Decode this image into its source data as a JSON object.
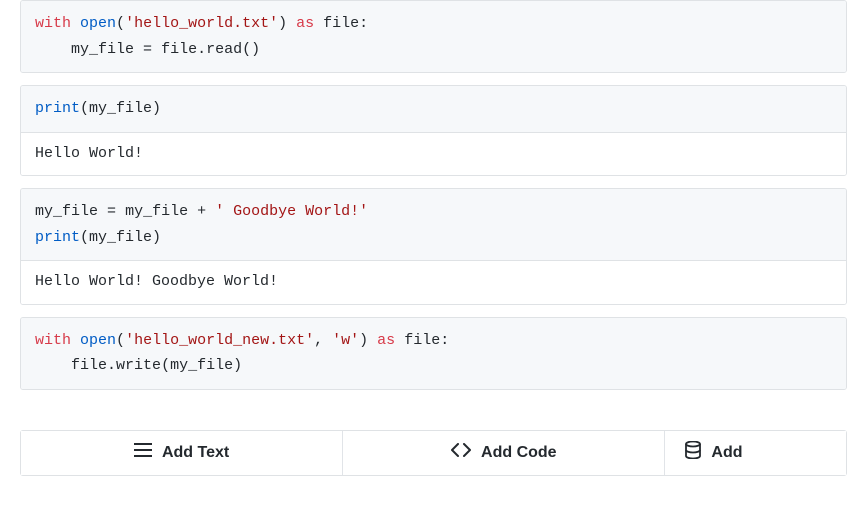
{
  "cells": [
    {
      "code_tokens": [
        [
          "keyword",
          "with"
        ],
        [
          "space",
          " "
        ],
        [
          "builtin",
          "open"
        ],
        [
          "punct",
          "("
        ],
        [
          "string",
          "'hello_world.txt'"
        ],
        [
          "punct",
          ")"
        ],
        [
          "space",
          " "
        ],
        [
          "keyword",
          "as"
        ],
        [
          "space",
          " "
        ],
        [
          "variable",
          "file"
        ],
        [
          "punct",
          ":"
        ],
        [
          "newline",
          "\n"
        ],
        [
          "space",
          "    "
        ],
        [
          "variable",
          "my_file"
        ],
        [
          "space",
          " "
        ],
        [
          "punct",
          "="
        ],
        [
          "space",
          " "
        ],
        [
          "variable",
          "file"
        ],
        [
          "punct",
          "."
        ],
        [
          "variable",
          "read"
        ],
        [
          "punct",
          "()"
        ]
      ],
      "output": null
    },
    {
      "code_tokens": [
        [
          "builtin",
          "print"
        ],
        [
          "punct",
          "("
        ],
        [
          "variable",
          "my_file"
        ],
        [
          "punct",
          ")"
        ]
      ],
      "output": "Hello World!"
    },
    {
      "code_tokens": [
        [
          "variable",
          "my_file"
        ],
        [
          "space",
          " "
        ],
        [
          "punct",
          "="
        ],
        [
          "space",
          " "
        ],
        [
          "variable",
          "my_file"
        ],
        [
          "space",
          " "
        ],
        [
          "punct",
          "+"
        ],
        [
          "space",
          " "
        ],
        [
          "string",
          "' Goodbye World!'"
        ],
        [
          "newline",
          "\n"
        ],
        [
          "builtin",
          "print"
        ],
        [
          "punct",
          "("
        ],
        [
          "variable",
          "my_file"
        ],
        [
          "punct",
          ")"
        ]
      ],
      "output": "Hello World! Goodbye World!"
    },
    {
      "code_tokens": [
        [
          "keyword",
          "with"
        ],
        [
          "space",
          " "
        ],
        [
          "builtin",
          "open"
        ],
        [
          "punct",
          "("
        ],
        [
          "string",
          "'hello_world_new.txt'"
        ],
        [
          "punct",
          ","
        ],
        [
          "space",
          " "
        ],
        [
          "string",
          "'w'"
        ],
        [
          "punct",
          ")"
        ],
        [
          "space",
          " "
        ],
        [
          "keyword",
          "as"
        ],
        [
          "space",
          " "
        ],
        [
          "variable",
          "file"
        ],
        [
          "punct",
          ":"
        ],
        [
          "newline",
          "\n"
        ],
        [
          "space",
          "    "
        ],
        [
          "variable",
          "file"
        ],
        [
          "punct",
          "."
        ],
        [
          "variable",
          "write"
        ],
        [
          "punct",
          "("
        ],
        [
          "variable",
          "my_file"
        ],
        [
          "punct",
          ")"
        ]
      ],
      "output": null
    }
  ],
  "toolbar": {
    "add_text_label": "Add Text",
    "add_code_label": "Add Code",
    "add_other_label": "Add"
  }
}
